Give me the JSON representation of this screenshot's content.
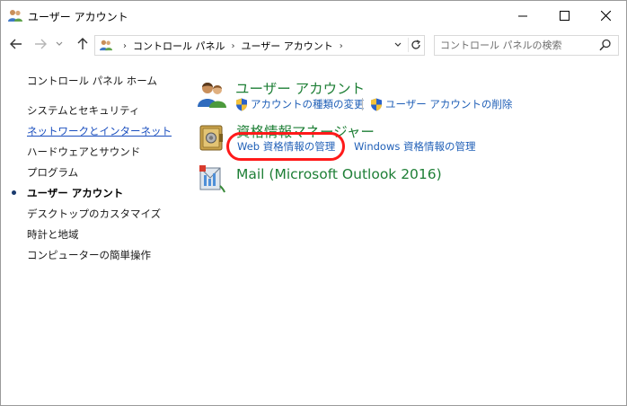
{
  "window": {
    "title": "ユーザー アカウント"
  },
  "address": {
    "crumbs": [
      "コントロール パネル",
      "ユーザー アカウント"
    ],
    "search_placeholder": "コントロール パネルの検索"
  },
  "leftnav": {
    "home": "コントロール パネル ホーム",
    "items": [
      "システムとセキュリティ",
      "ネットワークとインターネット",
      "ハードウェアとサウンド",
      "プログラム",
      "ユーザー アカウント",
      "デスクトップのカスタマイズ",
      "時計と地域",
      "コンピューターの簡単操作"
    ]
  },
  "main": {
    "user_accounts": {
      "title": "ユーザー アカウント",
      "tasks": [
        "アカウントの種類の変更",
        "ユーザー アカウントの削除"
      ]
    },
    "credential_manager": {
      "title": "資格情報マネージャー",
      "tasks": [
        "Web 資格情報の管理",
        "Windows 資格情報の管理"
      ]
    },
    "mail": {
      "title": "Mail (Microsoft Outlook 2016)"
    }
  },
  "colors": {
    "category_title": "#1e7f36",
    "task_link": "#1f5fb7",
    "highlight": "#ff1a1a"
  }
}
